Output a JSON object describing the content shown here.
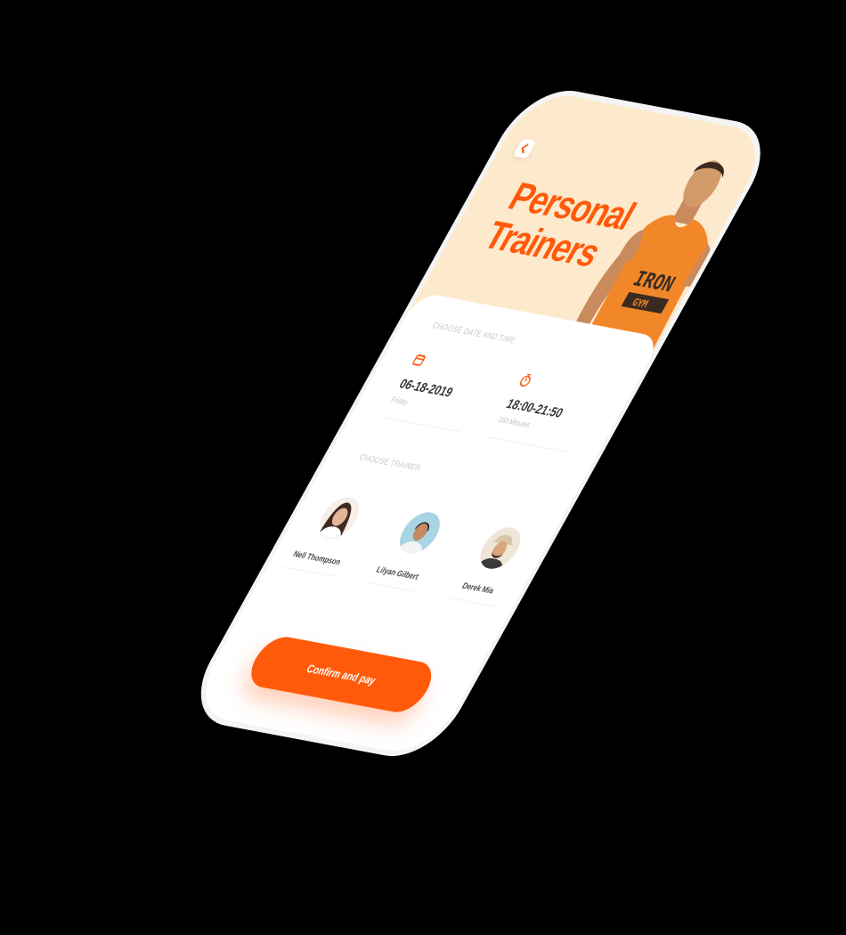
{
  "hero": {
    "title_line1": "Personal",
    "title_line2": "Trainers",
    "shirt_text_top": "IRON",
    "shirt_text_bottom": "GYM"
  },
  "booking": {
    "section_label": "CHOOSE DATE AND TIME",
    "date_value": "06-18-2019",
    "date_label": "Friday",
    "time_value": "18:00-21:50",
    "time_label": "150 Minutes"
  },
  "trainers": {
    "section_label": "CHOOSE TRAINER",
    "items": [
      {
        "name": "Nell Thompson"
      },
      {
        "name": "Lilyan Gilbert"
      },
      {
        "name": "Derek Mia"
      }
    ]
  },
  "footer": {
    "confirm_label": "Confirm and pay"
  },
  "colors": {
    "accent": "#ff5a0a",
    "hero_bg": "#fde9cc",
    "background": "#000000"
  },
  "icons": [
    "back-chevron-icon",
    "calendar-icon",
    "stopwatch-icon"
  ]
}
